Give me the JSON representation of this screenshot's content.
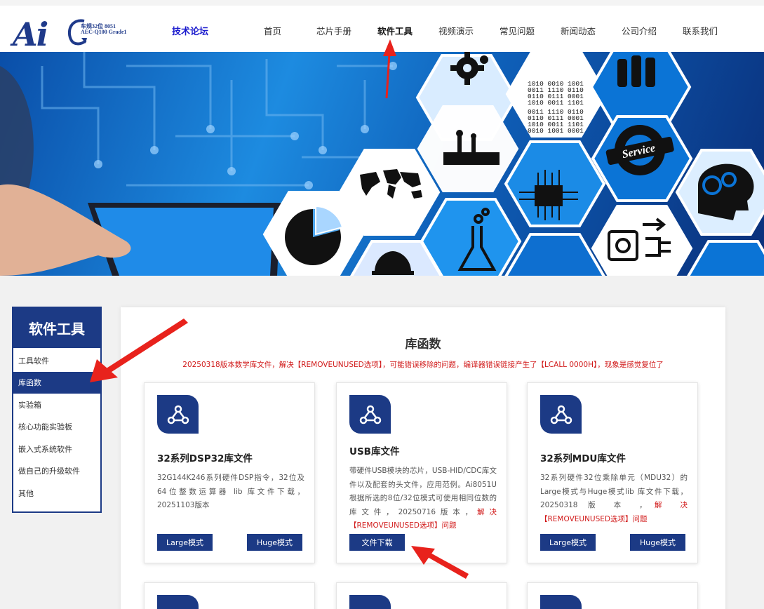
{
  "header": {
    "logo_text": "Ai",
    "logo_tag1": "车规32位 8051",
    "logo_tag2": "AEC-Q100 Grade1",
    "forum_link": "技术论坛",
    "nav": [
      {
        "label": "首页"
      },
      {
        "label": "芯片手册"
      },
      {
        "label": "软件工具"
      },
      {
        "label": "视频演示"
      },
      {
        "label": "常见问题"
      },
      {
        "label": "新闻动态"
      },
      {
        "label": "公司介绍"
      },
      {
        "label": "联系我们"
      }
    ],
    "active_nav": "软件工具"
  },
  "banner": {
    "binary_lines": [
      "1010 0010 1001",
      "0011 1110 0110",
      "0110 0111 0001",
      "1010 0011 1101",
      "0011 1110 0110",
      "0110 0111 0001",
      "1010 0011 1101",
      "0010 1001 0001"
    ],
    "service_text": "Service"
  },
  "sidebar": {
    "title": "软件工具",
    "items": [
      {
        "label": "工具软件"
      },
      {
        "label": "库函数"
      },
      {
        "label": "实验箱"
      },
      {
        "label": "核心功能实验板"
      },
      {
        "label": "嵌入式系统软件"
      },
      {
        "label": "做自己的升级软件"
      },
      {
        "label": "其他"
      }
    ],
    "active_item": "库函数"
  },
  "main": {
    "title": "库函数",
    "notice": "20250318版本数学库文件，解决【REMOVEUNUSED选项】，可能错误移除的问题，编译器错误链接产生了【LCALL  0000H】，现象是感觉复位了",
    "cards": [
      {
        "title": "32系列DSP32库文件",
        "desc": "32G144K246系列硬件DSP指令，32位及64位整数运算器 lib 库文件下载，20251103版本",
        "desc_red": "",
        "buttons": [
          "Large模式",
          "Huge模式"
        ],
        "icon": "share-icon"
      },
      {
        "title": "USB库文件",
        "desc": "带硬件USB模块的芯片，USB-HID/CDC库文件以及配套的头文件，应用范例。Ai8051U根据所选的8位/32位模式可使用相同位数的库文件，20250716版本，",
        "desc_red": "解决【REMOVEUNUSED选项】问题",
        "buttons": [
          "文件下载"
        ],
        "icon": "share-icon"
      },
      {
        "title": "32系列MDU库文件",
        "desc": "32系列硬件32位乘除单元（MDU32）的Large模式与Huge模式lib 库文件下载，20250318 版 本 ，",
        "desc_red": "解 决【REMOVEUNUSED选项】问题",
        "buttons": [
          "Large模式",
          "Huge模式"
        ],
        "icon": "share-icon"
      }
    ]
  },
  "colors": {
    "brand": "#1c3a85",
    "notice_red": "#d11a1a",
    "annotation_red": "#e8221c"
  }
}
